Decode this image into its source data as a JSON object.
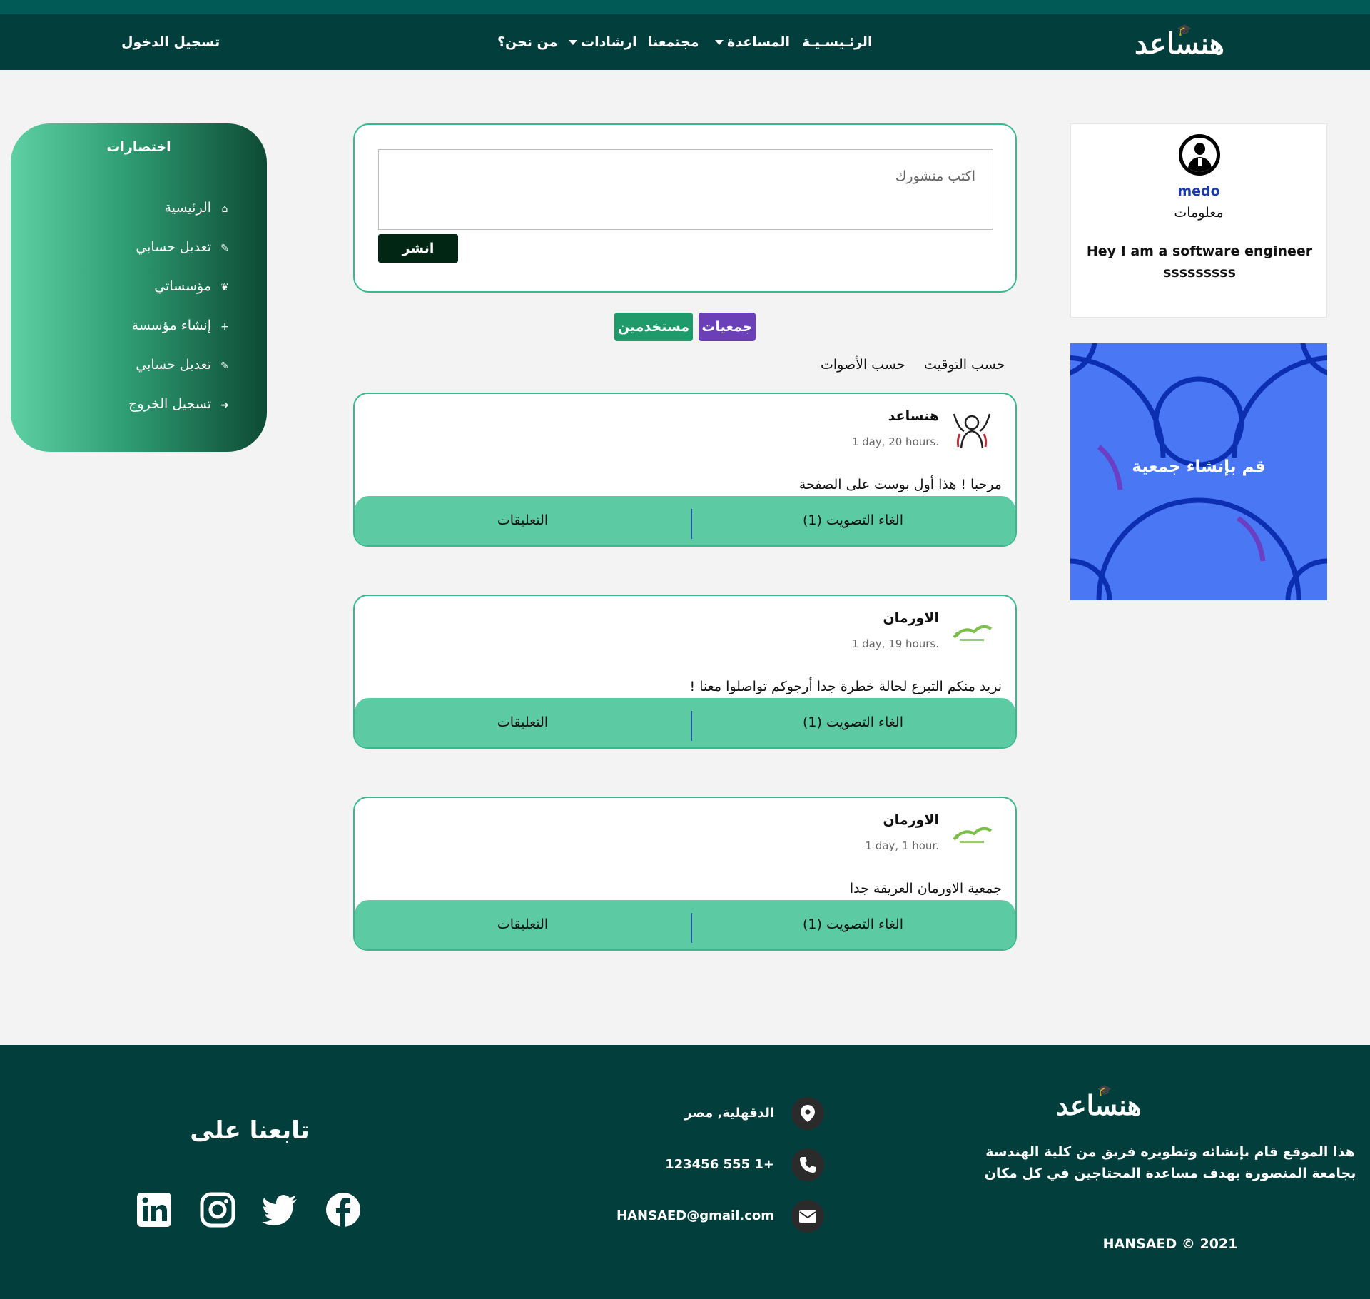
{
  "nav": {
    "logo": "هنساعد",
    "links": {
      "home": "الرئـيسـيـة",
      "help": "المساعدة",
      "community": "مجتمعنا",
      "guidance": "ارشادات",
      "about": "من نحن؟",
      "login": "تسجيل الدخول"
    }
  },
  "profile": {
    "name": "medo",
    "info_label": "معلومات",
    "bio": "Hey I am a software engineer sssssssss"
  },
  "banner": {
    "text": "قم بإنشاء جمعية"
  },
  "composer": {
    "placeholder": "اكتب منشورك",
    "publish_label": "انشر"
  },
  "filters": {
    "societies": "جمعيات",
    "users": "مستخدمين"
  },
  "sort": {
    "by_time": "حسب التوقيت",
    "by_votes": "حسب الأصوات"
  },
  "posts": [
    {
      "author": "هنساعد",
      "time": "1 day, 20 hours.",
      "text": "مرحبا ! هذا أول بوست على الصفحة",
      "vote_label": "الغاء التصويت (1)",
      "comments_label": "التعليقات"
    },
    {
      "author": "الاورمان",
      "time": "1 day, 19 hours.",
      "text": "نريد منكم التبرع لحالة خطرة جدا أرجوكم تواصلوا معنا !",
      "vote_label": "الغاء التصويت (1)",
      "comments_label": "التعليقات"
    },
    {
      "author": "الاورمان",
      "time": "1 day, 1 hour.",
      "text": "جمعية الاورمان العريقة جدا",
      "vote_label": "الغاء التصويت (1)",
      "comments_label": "التعليقات"
    }
  ],
  "shortcuts": {
    "title": "اختصارات",
    "items": [
      {
        "label": "الرئيسية",
        "icon": "home-icon"
      },
      {
        "label": "تعديل حسابي",
        "icon": "edit-icon"
      },
      {
        "label": "مؤسساتي",
        "icon": "leaf-icon"
      },
      {
        "label": "إنشاء مؤسسة",
        "icon": "plus-icon"
      },
      {
        "label": "تعديل حسابي",
        "icon": "edit-icon"
      },
      {
        "label": "تسجيل الخروج",
        "icon": "logout-icon"
      }
    ]
  },
  "footer": {
    "logo": "هنساعد",
    "description": "هذا الموقع قام بإنشائه وتطويره فريق من كلية الهندسة بجامعة المنصورة بهدف مساعدة المحتاجين في كل مكان",
    "copyright": "HANSAED © 2021",
    "address": "الدقهلية, مصر",
    "phone": "+1 555 123456",
    "email": "HANSAED@gmail.com",
    "follow_title": "تابعنا على",
    "social": [
      "linkedin-icon",
      "instagram-icon",
      "twitter-icon",
      "facebook-icon"
    ]
  },
  "colors": {
    "nav_bg": "#023f3c",
    "accent_green": "#5ccba4",
    "border_green": "#37b98f",
    "purple": "#6a3fb8",
    "teal_button": "#1f9a6a",
    "banner_blue": "#4a78f5"
  }
}
